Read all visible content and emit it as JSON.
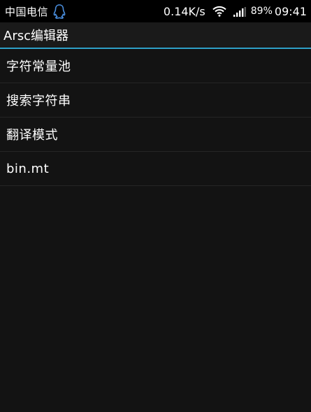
{
  "status_bar": {
    "carrier": "中国电信",
    "notification_icon": "qq-penguin-icon",
    "net_speed": "0.14K/s",
    "wifi_icon": "wifi-icon",
    "signal_icon": "signal-bars-icon",
    "battery": "89%",
    "time": "09:41"
  },
  "action_bar": {
    "title": "Arsc编辑器",
    "accent_color": "#2ea0c8"
  },
  "menu": {
    "items": [
      {
        "label": "字符常量池"
      },
      {
        "label": "搜索字符串"
      },
      {
        "label": "翻译模式"
      },
      {
        "label": "bin.mt"
      }
    ]
  }
}
